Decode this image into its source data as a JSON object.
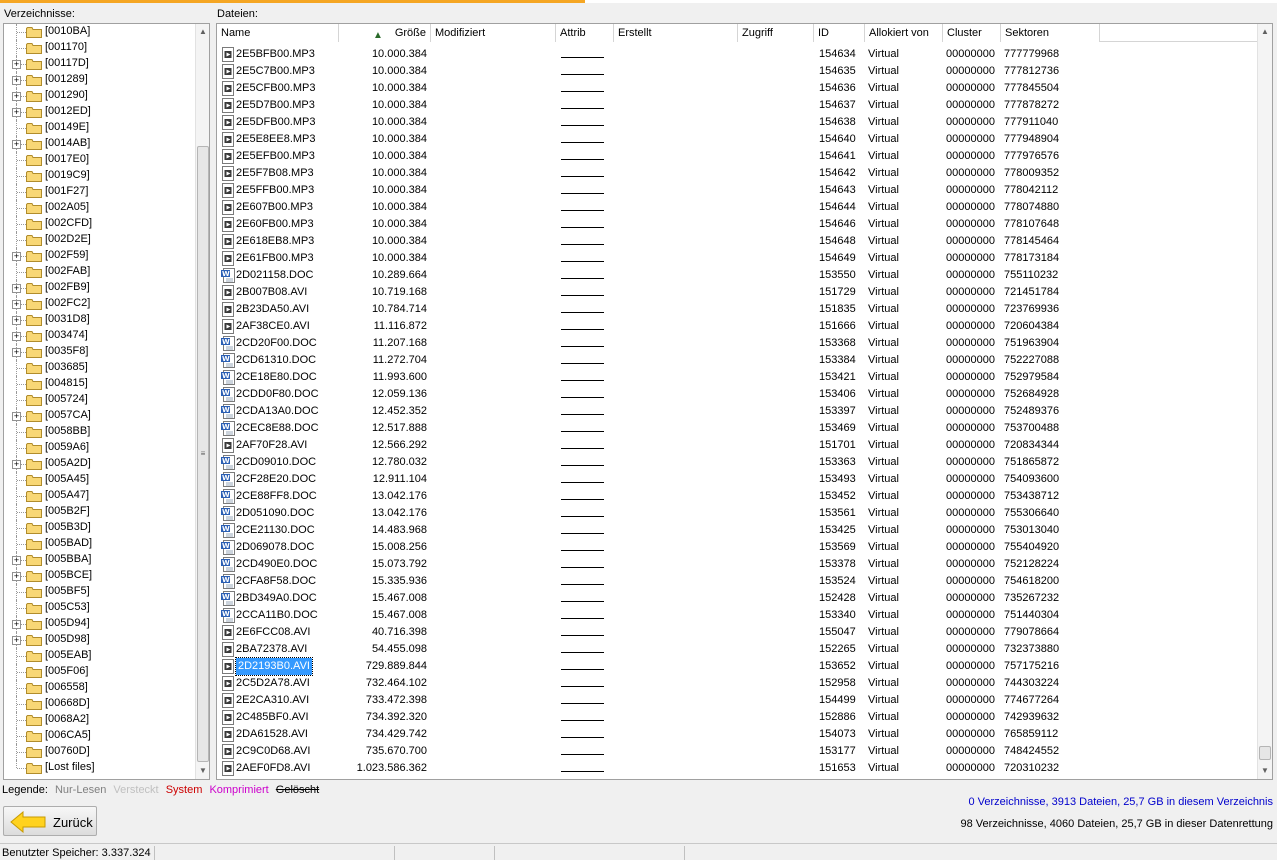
{
  "tree_label": "Verzeichnisse:",
  "files_label": "Dateien:",
  "tree_items": [
    {
      "label": "[0010BA]",
      "expandable": false
    },
    {
      "label": "[001170]",
      "expandable": false
    },
    {
      "label": "[00117D]",
      "expandable": true
    },
    {
      "label": "[001289]",
      "expandable": true
    },
    {
      "label": "[001290]",
      "expandable": true
    },
    {
      "label": "[0012ED]",
      "expandable": true
    },
    {
      "label": "[00149E]",
      "expandable": false
    },
    {
      "label": "[0014AB]",
      "expandable": true
    },
    {
      "label": "[0017E0]",
      "expandable": false
    },
    {
      "label": "[0019C9]",
      "expandable": false
    },
    {
      "label": "[001F27]",
      "expandable": false
    },
    {
      "label": "[002A05]",
      "expandable": false
    },
    {
      "label": "[002CFD]",
      "expandable": false
    },
    {
      "label": "[002D2E]",
      "expandable": false
    },
    {
      "label": "[002F59]",
      "expandable": true
    },
    {
      "label": "[002FAB]",
      "expandable": false
    },
    {
      "label": "[002FB9]",
      "expandable": true
    },
    {
      "label": "[002FC2]",
      "expandable": true
    },
    {
      "label": "[0031D8]",
      "expandable": true
    },
    {
      "label": "[003474]",
      "expandable": true
    },
    {
      "label": "[0035F8]",
      "expandable": true
    },
    {
      "label": "[003685]",
      "expandable": false
    },
    {
      "label": "[004815]",
      "expandable": false
    },
    {
      "label": "[005724]",
      "expandable": false
    },
    {
      "label": "[0057CA]",
      "expandable": true
    },
    {
      "label": "[0058BB]",
      "expandable": false
    },
    {
      "label": "[0059A6]",
      "expandable": false
    },
    {
      "label": "[005A2D]",
      "expandable": true
    },
    {
      "label": "[005A45]",
      "expandable": false
    },
    {
      "label": "[005A47]",
      "expandable": false
    },
    {
      "label": "[005B2F]",
      "expandable": false
    },
    {
      "label": "[005B3D]",
      "expandable": false
    },
    {
      "label": "[005BAD]",
      "expandable": false
    },
    {
      "label": "[005BBA]",
      "expandable": true
    },
    {
      "label": "[005BCE]",
      "expandable": true
    },
    {
      "label": "[005BF5]",
      "expandable": false
    },
    {
      "label": "[005C53]",
      "expandable": false
    },
    {
      "label": "[005D94]",
      "expandable": true
    },
    {
      "label": "[005D98]",
      "expandable": true
    },
    {
      "label": "[005EAB]",
      "expandable": false
    },
    {
      "label": "[005F06]",
      "expandable": false
    },
    {
      "label": "[006558]",
      "expandable": false
    },
    {
      "label": "[00668D]",
      "expandable": false
    },
    {
      "label": "[0068A2]",
      "expandable": false
    },
    {
      "label": "[006CA5]",
      "expandable": false
    },
    {
      "label": "[00760D]",
      "expandable": false
    },
    {
      "label": "[Lost files]",
      "expandable": false
    }
  ],
  "columns": {
    "name": "Name",
    "size": "Größe",
    "modified": "Modifiziert",
    "attrib": "Attrib",
    "created": "Erstellt",
    "accessed": "Zugriff",
    "id": "ID",
    "allocated": "Allokiert von",
    "cluster": "Cluster",
    "sectors": "Sektoren"
  },
  "files": [
    {
      "name": "2E5BFB00.MP3",
      "size": "10.000.384",
      "id": "154634",
      "alloc": "Virtual",
      "cluster": "00000000",
      "sectors": "777779968",
      "type": "media"
    },
    {
      "name": "2E5C7B00.MP3",
      "size": "10.000.384",
      "id": "154635",
      "alloc": "Virtual",
      "cluster": "00000000",
      "sectors": "777812736",
      "type": "media"
    },
    {
      "name": "2E5CFB00.MP3",
      "size": "10.000.384",
      "id": "154636",
      "alloc": "Virtual",
      "cluster": "00000000",
      "sectors": "777845504",
      "type": "media"
    },
    {
      "name": "2E5D7B00.MP3",
      "size": "10.000.384",
      "id": "154637",
      "alloc": "Virtual",
      "cluster": "00000000",
      "sectors": "777878272",
      "type": "media"
    },
    {
      "name": "2E5DFB00.MP3",
      "size": "10.000.384",
      "id": "154638",
      "alloc": "Virtual",
      "cluster": "00000000",
      "sectors": "777911040",
      "type": "media"
    },
    {
      "name": "2E5E8EE8.MP3",
      "size": "10.000.384",
      "id": "154640",
      "alloc": "Virtual",
      "cluster": "00000000",
      "sectors": "777948904",
      "type": "media"
    },
    {
      "name": "2E5EFB00.MP3",
      "size": "10.000.384",
      "id": "154641",
      "alloc": "Virtual",
      "cluster": "00000000",
      "sectors": "777976576",
      "type": "media"
    },
    {
      "name": "2E5F7B08.MP3",
      "size": "10.000.384",
      "id": "154642",
      "alloc": "Virtual",
      "cluster": "00000000",
      "sectors": "778009352",
      "type": "media"
    },
    {
      "name": "2E5FFB00.MP3",
      "size": "10.000.384",
      "id": "154643",
      "alloc": "Virtual",
      "cluster": "00000000",
      "sectors": "778042112",
      "type": "media"
    },
    {
      "name": "2E607B00.MP3",
      "size": "10.000.384",
      "id": "154644",
      "alloc": "Virtual",
      "cluster": "00000000",
      "sectors": "778074880",
      "type": "media"
    },
    {
      "name": "2E60FB00.MP3",
      "size": "10.000.384",
      "id": "154646",
      "alloc": "Virtual",
      "cluster": "00000000",
      "sectors": "778107648",
      "type": "media"
    },
    {
      "name": "2E618EB8.MP3",
      "size": "10.000.384",
      "id": "154648",
      "alloc": "Virtual",
      "cluster": "00000000",
      "sectors": "778145464",
      "type": "media"
    },
    {
      "name": "2E61FB00.MP3",
      "size": "10.000.384",
      "id": "154649",
      "alloc": "Virtual",
      "cluster": "00000000",
      "sectors": "778173184",
      "type": "media"
    },
    {
      "name": "2D021158.DOC",
      "size": "10.289.664",
      "id": "153550",
      "alloc": "Virtual",
      "cluster": "00000000",
      "sectors": "755110232",
      "type": "doc"
    },
    {
      "name": "2B007B08.AVI",
      "size": "10.719.168",
      "id": "151729",
      "alloc": "Virtual",
      "cluster": "00000000",
      "sectors": "721451784",
      "type": "media"
    },
    {
      "name": "2B23DA50.AVI",
      "size": "10.784.714",
      "id": "151835",
      "alloc": "Virtual",
      "cluster": "00000000",
      "sectors": "723769936",
      "type": "media"
    },
    {
      "name": "2AF38CE0.AVI",
      "size": "11.116.872",
      "id": "151666",
      "alloc": "Virtual",
      "cluster": "00000000",
      "sectors": "720604384",
      "type": "media"
    },
    {
      "name": "2CD20F00.DOC",
      "size": "11.207.168",
      "id": "153368",
      "alloc": "Virtual",
      "cluster": "00000000",
      "sectors": "751963904",
      "type": "doc"
    },
    {
      "name": "2CD61310.DOC",
      "size": "11.272.704",
      "id": "153384",
      "alloc": "Virtual",
      "cluster": "00000000",
      "sectors": "752227088",
      "type": "doc"
    },
    {
      "name": "2CE18E80.DOC",
      "size": "11.993.600",
      "id": "153421",
      "alloc": "Virtual",
      "cluster": "00000000",
      "sectors": "752979584",
      "type": "doc"
    },
    {
      "name": "2CDD0F80.DOC",
      "size": "12.059.136",
      "id": "153406",
      "alloc": "Virtual",
      "cluster": "00000000",
      "sectors": "752684928",
      "type": "doc"
    },
    {
      "name": "2CDA13A0.DOC",
      "size": "12.452.352",
      "id": "153397",
      "alloc": "Virtual",
      "cluster": "00000000",
      "sectors": "752489376",
      "type": "doc"
    },
    {
      "name": "2CEC8E88.DOC",
      "size": "12.517.888",
      "id": "153469",
      "alloc": "Virtual",
      "cluster": "00000000",
      "sectors": "753700488",
      "type": "doc"
    },
    {
      "name": "2AF70F28.AVI",
      "size": "12.566.292",
      "id": "151701",
      "alloc": "Virtual",
      "cluster": "00000000",
      "sectors": "720834344",
      "type": "media"
    },
    {
      "name": "2CD09010.DOC",
      "size": "12.780.032",
      "id": "153363",
      "alloc": "Virtual",
      "cluster": "00000000",
      "sectors": "751865872",
      "type": "doc"
    },
    {
      "name": "2CF28E20.DOC",
      "size": "12.911.104",
      "id": "153493",
      "alloc": "Virtual",
      "cluster": "00000000",
      "sectors": "754093600",
      "type": "doc"
    },
    {
      "name": "2CE88FF8.DOC",
      "size": "13.042.176",
      "id": "153452",
      "alloc": "Virtual",
      "cluster": "00000000",
      "sectors": "753438712",
      "type": "doc"
    },
    {
      "name": "2D051090.DOC",
      "size": "13.042.176",
      "id": "153561",
      "alloc": "Virtual",
      "cluster": "00000000",
      "sectors": "755306640",
      "type": "doc"
    },
    {
      "name": "2CE21130.DOC",
      "size": "14.483.968",
      "id": "153425",
      "alloc": "Virtual",
      "cluster": "00000000",
      "sectors": "753013040",
      "type": "doc"
    },
    {
      "name": "2D069078.DOC",
      "size": "15.008.256",
      "id": "153569",
      "alloc": "Virtual",
      "cluster": "00000000",
      "sectors": "755404920",
      "type": "doc"
    },
    {
      "name": "2CD490E0.DOC",
      "size": "15.073.792",
      "id": "153378",
      "alloc": "Virtual",
      "cluster": "00000000",
      "sectors": "752128224",
      "type": "doc"
    },
    {
      "name": "2CFA8F58.DOC",
      "size": "15.335.936",
      "id": "153524",
      "alloc": "Virtual",
      "cluster": "00000000",
      "sectors": "754618200",
      "type": "doc"
    },
    {
      "name": "2BD349A0.DOC",
      "size": "15.467.008",
      "id": "152428",
      "alloc": "Virtual",
      "cluster": "00000000",
      "sectors": "735267232",
      "type": "doc"
    },
    {
      "name": "2CCA11B0.DOC",
      "size": "15.467.008",
      "id": "153340",
      "alloc": "Virtual",
      "cluster": "00000000",
      "sectors": "751440304",
      "type": "doc"
    },
    {
      "name": "2E6FCC08.AVI",
      "size": "40.716.398",
      "id": "155047",
      "alloc": "Virtual",
      "cluster": "00000000",
      "sectors": "779078664",
      "type": "media"
    },
    {
      "name": "2BA72378.AVI",
      "size": "54.455.098",
      "id": "152265",
      "alloc": "Virtual",
      "cluster": "00000000",
      "sectors": "732373880",
      "type": "media"
    },
    {
      "name": "2D2193B0.AVI",
      "size": "729.889.844",
      "id": "153652",
      "alloc": "Virtual",
      "cluster": "00000000",
      "sectors": "757175216",
      "type": "media",
      "selected": true
    },
    {
      "name": "2C5D2A78.AVI",
      "size": "732.464.102",
      "id": "152958",
      "alloc": "Virtual",
      "cluster": "00000000",
      "sectors": "744303224",
      "type": "media"
    },
    {
      "name": "2E2CA310.AVI",
      "size": "733.472.398",
      "id": "154499",
      "alloc": "Virtual",
      "cluster": "00000000",
      "sectors": "774677264",
      "type": "media"
    },
    {
      "name": "2C485BF0.AVI",
      "size": "734.392.320",
      "id": "152886",
      "alloc": "Virtual",
      "cluster": "00000000",
      "sectors": "742939632",
      "type": "media"
    },
    {
      "name": "2DA61528.AVI",
      "size": "734.429.742",
      "id": "154073",
      "alloc": "Virtual",
      "cluster": "00000000",
      "sectors": "765859112",
      "type": "media"
    },
    {
      "name": "2C9C0D68.AVI",
      "size": "735.670.700",
      "id": "153177",
      "alloc": "Virtual",
      "cluster": "00000000",
      "sectors": "748424552",
      "type": "media"
    },
    {
      "name": "2AEF0FD8.AVI",
      "size": "1.023.586.362",
      "id": "151653",
      "alloc": "Virtual",
      "cluster": "00000000",
      "sectors": "720310232",
      "type": "media"
    }
  ],
  "legend": {
    "title": "Legende:",
    "readonly": "Nur-Lesen",
    "hidden": "Versteckt",
    "system": "System",
    "compressed": "Komprimiert",
    "deleted": "Gelöscht",
    "colors": {
      "readonly": "#808080",
      "hidden": "#c0c0c0",
      "system": "#cc0000",
      "compressed": "#cc00cc",
      "deleted": "#000000"
    }
  },
  "back_button": "Zurück",
  "stats": {
    "current_dir": "0 Verzeichnisse, 3913 Dateien, 25,7 GB in diesem Verzeichnis",
    "total": "98 Verzeichnisse, 4060 Dateien, 25,7 GB in dieser Datenrettung"
  },
  "status_bar": "Benutzter Speicher: 3.337.324",
  "colors": {
    "selection": "#3399ff",
    "stats_blue": "#0000cc",
    "folder": "#f8d775",
    "accent": "#f5a623"
  }
}
